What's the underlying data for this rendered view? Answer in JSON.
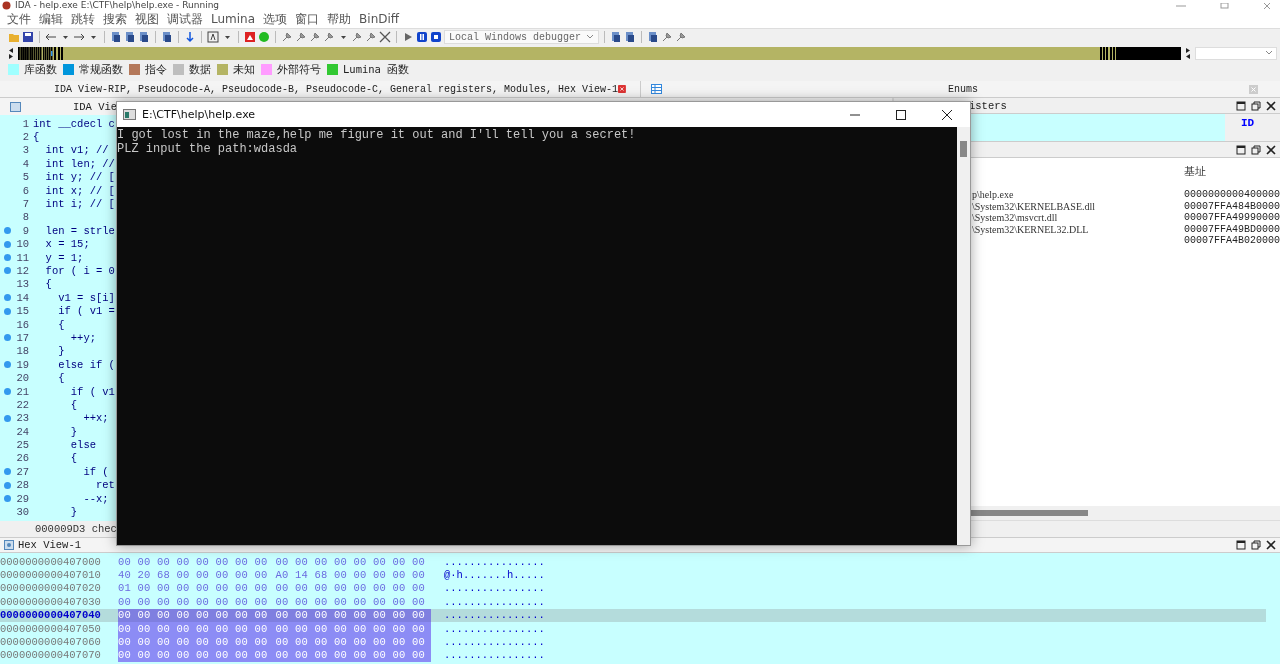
{
  "window": {
    "title": "IDA - help.exe E:\\CTF\\help\\help.exe - Running"
  },
  "menu": [
    "文件",
    "编辑",
    "跳转",
    "搜索",
    "视图",
    "调试器",
    "Lumina",
    "选项",
    "窗口",
    "帮助",
    "BinDiff"
  ],
  "toolbar": {
    "debugger": "Local Windows debugger"
  },
  "legend": [
    {
      "label": "库函数",
      "color": "#a0ffff"
    },
    {
      "label": "常规函数",
      "color": "#0096dc"
    },
    {
      "label": "指令",
      "color": "#b4785a"
    },
    {
      "label": "数据",
      "color": "#bebebe"
    },
    {
      "label": "未知",
      "color": "#b4b464"
    },
    {
      "label": "外部符号",
      "color": "#ff9cff"
    },
    {
      "label": "Lumina 函数",
      "color": "#32c832"
    }
  ],
  "tab_bar": {
    "label": "IDA View-RIP, Pseudocode-A, Pseudocode-B, Pseudocode-C, General registers, Modules, Hex View-1",
    "side_label": "Enums"
  },
  "pseudocode": {
    "tab": "IDA Vie",
    "lines": [
      {
        "num": "1",
        "code": "int __cdecl c",
        "marked": false
      },
      {
        "num": "2",
        "code": "{",
        "marked": false
      },
      {
        "num": "3",
        "code": "  int v1; //",
        "marked": false
      },
      {
        "num": "4",
        "code": "  int len; //",
        "marked": false
      },
      {
        "num": "5",
        "code": "  int y; // [",
        "marked": false
      },
      {
        "num": "6",
        "code": "  int x; // [",
        "marked": false
      },
      {
        "num": "7",
        "code": "  int i; // [",
        "marked": false
      },
      {
        "num": "8",
        "marked": false
      },
      {
        "num": "9",
        "code": "  len = strle",
        "marked": true
      },
      {
        "num": "10",
        "code": "  x = 15;",
        "marked": true
      },
      {
        "num": "11",
        "code": "  y = 1;",
        "marked": true
      },
      {
        "num": "12",
        "code": "  for ( i = 0",
        "marked": true
      },
      {
        "num": "13",
        "code": "  {",
        "marked": false
      },
      {
        "num": "14",
        "code": "    v1 = s[i]",
        "marked": true
      },
      {
        "num": "15",
        "code": "    if ( v1 =",
        "marked": true
      },
      {
        "num": "16",
        "code": "    {",
        "marked": false
      },
      {
        "num": "17",
        "code": "      ++y;",
        "marked": true
      },
      {
        "num": "18",
        "code": "    }",
        "marked": false
      },
      {
        "num": "19",
        "code": "    else if (",
        "marked": true
      },
      {
        "num": "20",
        "code": "    {",
        "marked": false
      },
      {
        "num": "21",
        "code": "      if ( v1",
        "marked": true
      },
      {
        "num": "22",
        "code": "      {",
        "marked": false
      },
      {
        "num": "23",
        "code": "        ++x;",
        "marked": true
      },
      {
        "num": "24",
        "code": "      }",
        "marked": false
      },
      {
        "num": "25",
        "code": "      else",
        "marked": false
      },
      {
        "num": "26",
        "code": "      {",
        "marked": false
      },
      {
        "num": "27",
        "code": "        if (",
        "marked": true
      },
      {
        "num": "28",
        "code": "          ret",
        "marked": true
      },
      {
        "num": "29",
        "code": "        --x;",
        "marked": true
      },
      {
        "num": "30",
        "code": "      }",
        "marked": false
      }
    ],
    "status": "000009D3 chec"
  },
  "registers": {
    "title": "isters",
    "value": "ID"
  },
  "modules": {
    "columns": [
      "基址"
    ],
    "rows": [
      {
        "path": "p\\help.exe",
        "base": "0000000000400000"
      },
      {
        "path": "\\System32\\KERNELBASE.dll",
        "base": "00007FFA484B0000"
      },
      {
        "path": "\\System32\\msvcrt.dll",
        "base": "00007FFA49990000"
      },
      {
        "path": "\\System32\\KERNEL32.DLL",
        "base": "00007FFA49BD0000"
      },
      {
        "base": "00007FFA4B020000"
      }
    ]
  },
  "hex_view": {
    "title": "Hex View-1",
    "rows": [
      {
        "address": "0000000000407000",
        "hex_1": "00 00 00 00 00 00 00 00",
        "hex_2": "00 00 00 00 00 00 00 00",
        "ascii": "................",
        "current": false,
        "selected": false
      },
      {
        "address": "0000000000407010",
        "hex_1": "40 20 68 00 00 00 00 00",
        "hex_2": "A0 14 68 00 00 00 00 00",
        "ascii": "@·h.......h.....",
        "current": false,
        "selected": false
      },
      {
        "address": "0000000000407020",
        "hex_1": "01 00 00 00 00 00 00 00",
        "hex_2": "00 00 00 00 00 00 00 00",
        "ascii": "................",
        "current": false,
        "selected": false
      },
      {
        "address": "0000000000407030",
        "hex_1": "00 00 00 00 00 00 00 00",
        "hex_2": "00 00 00 00 00 00 00 00",
        "ascii": "................",
        "current": false,
        "selected": false
      },
      {
        "address": "0000000000407040",
        "hex_1": "00 00 00 00 00 00 00 00",
        "hex_2": "00 00 00 00 00 00 00 00",
        "ascii": "................",
        "current": true,
        "selected": true
      },
      {
        "address": "0000000000407050",
        "hex_1": "00 00 00 00 00 00 00 00",
        "hex_2": "00 00 00 00 00 00 00 00",
        "ascii": "................",
        "current": false,
        "selected": true
      },
      {
        "address": "0000000000407060",
        "hex_1": "00 00 00 00 00 00 00 00",
        "hex_2": "00 00 00 00 00 00 00 00",
        "ascii": "................",
        "current": false,
        "selected": true
      },
      {
        "address": "0000000000407070",
        "hex_1": "00 00 00 00 00 00 00 00",
        "hex_2": "00 00 00 00 00 00 00 00",
        "ascii": "................",
        "current": false,
        "selected": true
      }
    ]
  },
  "console": {
    "title": "E:\\CTF\\help\\help.exe",
    "lines": [
      "I got lost in the maze,help me figure it out and I'll tell you a secret!",
      "PLZ input the path:wdasda"
    ]
  }
}
